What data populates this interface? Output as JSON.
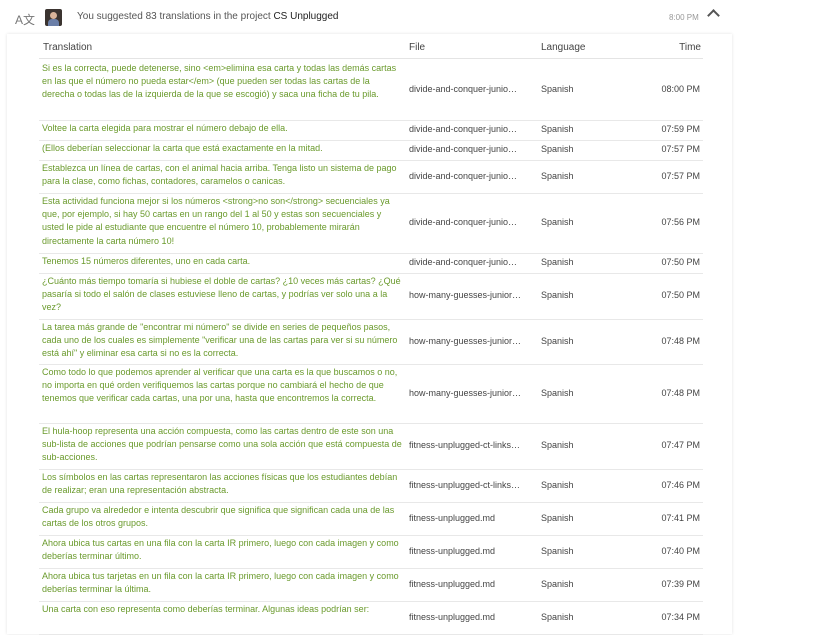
{
  "header": {
    "icon": "translate-icon",
    "summary_prefix": "You suggested 83 translations in the project",
    "project": "CS Unplugged",
    "time": "8:00 PM",
    "toggle_icon": "chevron-up-icon"
  },
  "table": {
    "columns": {
      "translation": "Translation",
      "file": "File",
      "language": "Language",
      "time": "Time"
    },
    "rows": [
      {
        "translation": "Si es la correcta, puede detenerse, sino <em>elimina esa carta y todas las demás cartas en las que el número no pueda estar</em> (que pueden ser todas las cartas de la derecha o todas las de la izquierda de la que se escogió) y saca una ficha de tu pila.",
        "file": "divide-and-conquer-junio…",
        "language": "Spanish",
        "time": "08:00 PM"
      },
      {
        "translation": "Voltee la carta elegida para mostrar el número debajo de ella.",
        "file": "divide-and-conquer-junio…",
        "language": "Spanish",
        "time": "07:59 PM"
      },
      {
        "translation": "(Ellos deberían seleccionar la carta que está exactamente en la mitad.",
        "file": "divide-and-conquer-junio…",
        "language": "Spanish",
        "time": "07:57 PM"
      },
      {
        "translation": "Establezca un línea de cartas, con el animal hacia arriba. Tenga listo un sistema de pago para la clase, como fichas, contadores, caramelos o canicas.",
        "file": "divide-and-conquer-junio…",
        "language": "Spanish",
        "time": "07:57 PM"
      },
      {
        "translation": "Esta actividad funciona mejor si los números <strong>no son</strong> secuenciales ya que, por ejemplo, si hay 50 cartas en un rango del 1 al 50 y estas son secuenciales y usted le pide al estudiante que encuentre el número 10, probablemente mirarán directamente la carta número 10!",
        "file": "divide-and-conquer-junio…",
        "language": "Spanish",
        "time": "07:56 PM"
      },
      {
        "translation": "Tenemos 15 números diferentes, uno en cada carta.",
        "file": "divide-and-conquer-junio…",
        "language": "Spanish",
        "time": "07:50 PM"
      },
      {
        "translation": "¿Cuánto más tiempo tomaría si hubiese el doble de cartas? ¿10 veces más cartas? ¿Qué pasaría si todo el salón de clases estuviese lleno de cartas, y podrías ver solo una a la vez?",
        "file": "how-many-guesses-junior…",
        "language": "Spanish",
        "time": "07:50 PM"
      },
      {
        "translation": "La tarea más grande de \"encontrar mi número\" se divide en series de pequeños pasos, cada uno de los cuales es simplemente \"verificar una de las cartas para ver si su número está ahí\" y eliminar esa carta si no es la correcta.",
        "file": "how-many-guesses-junior…",
        "language": "Spanish",
        "time": "07:48 PM"
      },
      {
        "translation": "Como todo lo que podemos aprender al verificar que una carta es la que buscamos o no, no importa en qué orden verifiquemos las cartas porque no cambiará el hecho de que tenemos que verificar cada cartas, una por una, hasta que encontremos la correcta.",
        "file": "how-many-guesses-junior…",
        "language": "Spanish",
        "time": "07:48 PM"
      },
      {
        "translation": "El hula-hoop representa una acción compuesta, como las cartas dentro de este son una sub-lista de acciones que podrían pensarse como una sola acción que está compuesta de sub-acciones.",
        "file": "fitness-unplugged-ct-links…",
        "language": "Spanish",
        "time": "07:47 PM"
      },
      {
        "translation": "Los símbolos en las cartas representaron las acciones físicas que los estudiantes debían de realizar; eran una representación abstracta.",
        "file": "fitness-unplugged-ct-links…",
        "language": "Spanish",
        "time": "07:46 PM"
      },
      {
        "translation": "Cada grupo va alrededor e intenta descubrir que significa que significan cada una de las cartas de los otros grupos.",
        "file": "fitness-unplugged.md",
        "language": "Spanish",
        "time": "07:41 PM"
      },
      {
        "translation": "Ahora ubica tus cartas en una fila con la carta IR primero, luego con cada imagen y como deberías terminar último.",
        "file": "fitness-unplugged.md",
        "language": "Spanish",
        "time": "07:40 PM"
      },
      {
        "translation": "Ahora ubica tus tarjetas en un fila con la carta IR primero, luego con cada imagen y como deberías terminar la última.",
        "file": "fitness-unplugged.md",
        "language": "Spanish",
        "time": "07:39 PM"
      },
      {
        "translation": "Una carta con eso representa como deberías terminar. Algunas ideas podrían ser:",
        "file": "fitness-unplugged.md",
        "language": "Spanish",
        "time": "07:34 PM"
      }
    ]
  }
}
